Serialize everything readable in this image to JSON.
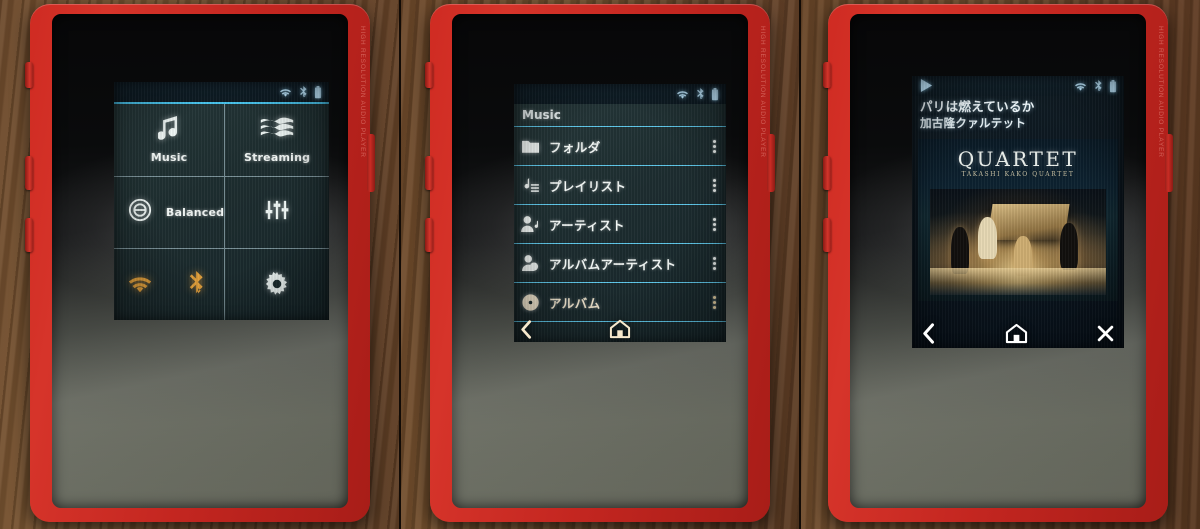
{
  "device": {
    "body_color": "#c6251f",
    "engraving": "HIGH RESOLUTION AUDIO PLAYER"
  },
  "statusbar": {
    "wifi_icon": "wifi-icon",
    "bluetooth_icon": "bluetooth-icon",
    "battery_icon": "battery-icon",
    "play_icon": "play-icon"
  },
  "panel1": {
    "label": "home-menu-screen",
    "tiles": [
      {
        "key": "music",
        "label": "Music",
        "icon": "music-note-icon",
        "tone": "white"
      },
      {
        "key": "streaming",
        "label": "Streaming",
        "icon": "wave-icon",
        "tone": "white"
      },
      {
        "key": "ess",
        "label": "",
        "icon": "circled-e-icon",
        "tone": "white"
      },
      {
        "key": "balanced",
        "label": "Balanced",
        "icon": "",
        "tone": "white"
      },
      {
        "key": "eq",
        "label": "",
        "icon": "equalizer-icon",
        "tone": "white"
      },
      {
        "key": "wifi",
        "label": "",
        "icon": "wifi-icon",
        "tone": "amber"
      },
      {
        "key": "bluetooth",
        "label": "",
        "icon": "bluetooth-icon",
        "tone": "amber"
      },
      {
        "key": "settings",
        "label": "",
        "icon": "gear-icon",
        "tone": "white"
      }
    ]
  },
  "panel2": {
    "label": "music-library-screen",
    "header": "Music",
    "rows": [
      {
        "label": "フォルダ",
        "icon": "folder-icon",
        "overflow": "overflow-menu-icon"
      },
      {
        "label": "プレイリスト",
        "icon": "playlist-icon",
        "overflow": "overflow-menu-icon"
      },
      {
        "label": "アーティスト",
        "icon": "artist-icon",
        "overflow": "overflow-menu-icon"
      },
      {
        "label": "アルバムアーティスト",
        "icon": "album-artist-icon",
        "overflow": "overflow-menu-icon"
      },
      {
        "label": "アルバム",
        "icon": "album-icon",
        "overflow": "overflow-menu-icon"
      }
    ],
    "nav": {
      "back": "back-chevron-icon",
      "home": "home-icon"
    }
  },
  "panel3": {
    "label": "now-playing-screen",
    "track_title": "パリは燃えているか",
    "track_artist": "加古隆クァルテット",
    "album_art": {
      "title": "QUARTET",
      "subtitle": "TAKASHI KAKO QUARTET",
      "scene": "string-quartet-on-stage-with-piano"
    },
    "nav": {
      "back": "back-chevron-icon",
      "home": "home-icon",
      "close": "close-x-icon"
    }
  }
}
